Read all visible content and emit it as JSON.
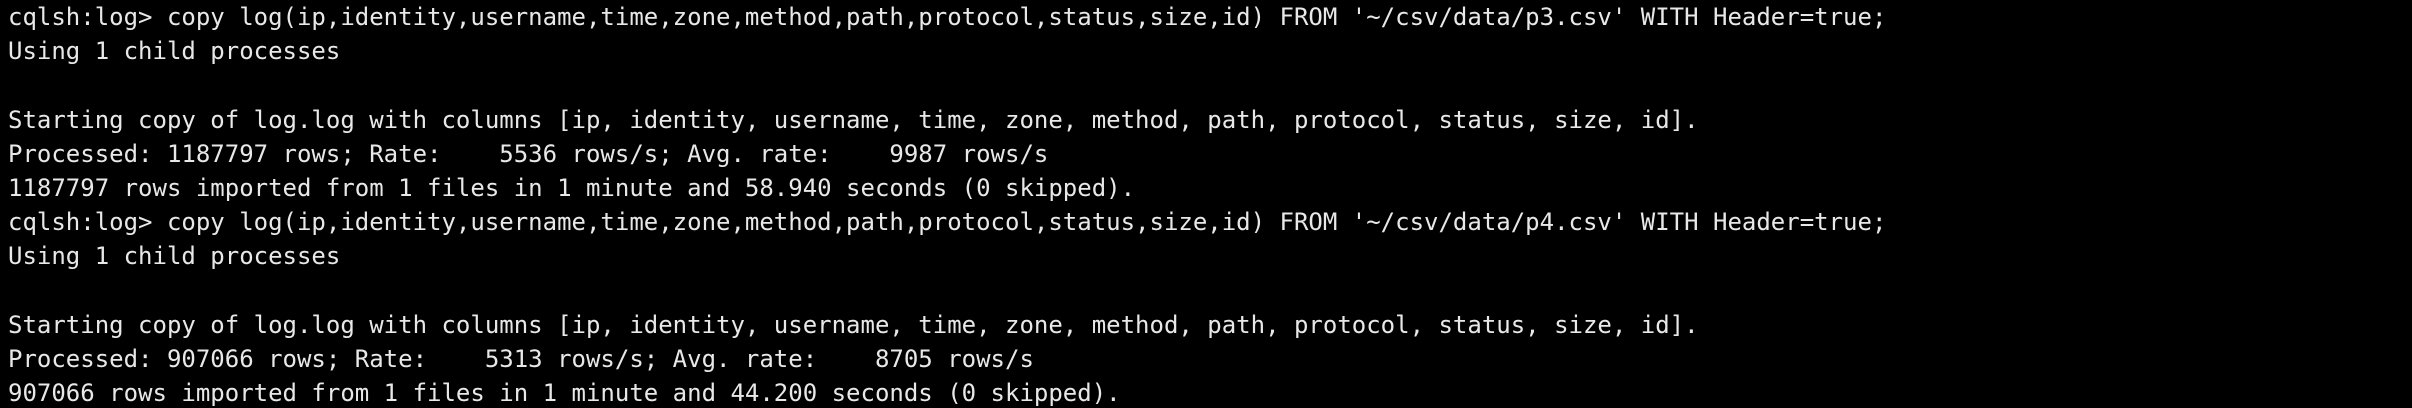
{
  "terminal": {
    "lines": [
      "cqlsh:log> copy log(ip,identity,username,time,zone,method,path,protocol,status,size,id) FROM '~/csv/data/p3.csv' WITH Header=true;",
      "Using 1 child processes",
      "",
      "Starting copy of log.log with columns [ip, identity, username, time, zone, method, path, protocol, status, size, id].",
      "Processed: 1187797 rows; Rate:    5536 rows/s; Avg. rate:    9987 rows/s",
      "1187797 rows imported from 1 files in 1 minute and 58.940 seconds (0 skipped).",
      "cqlsh:log> copy log(ip,identity,username,time,zone,method,path,protocol,status,size,id) FROM '~/csv/data/p4.csv' WITH Header=true;",
      "Using 1 child processes",
      "",
      "Starting copy of log.log with columns [ip, identity, username, time, zone, method, path, protocol, status, size, id].",
      "Processed: 907066 rows; Rate:    5313 rows/s; Avg. rate:    8705 rows/s",
      "907066 rows imported from 1 files in 1 minute and 44.200 seconds (0 skipped)."
    ]
  },
  "colors": {
    "background": "#000000",
    "text": "#e8e8e8"
  }
}
